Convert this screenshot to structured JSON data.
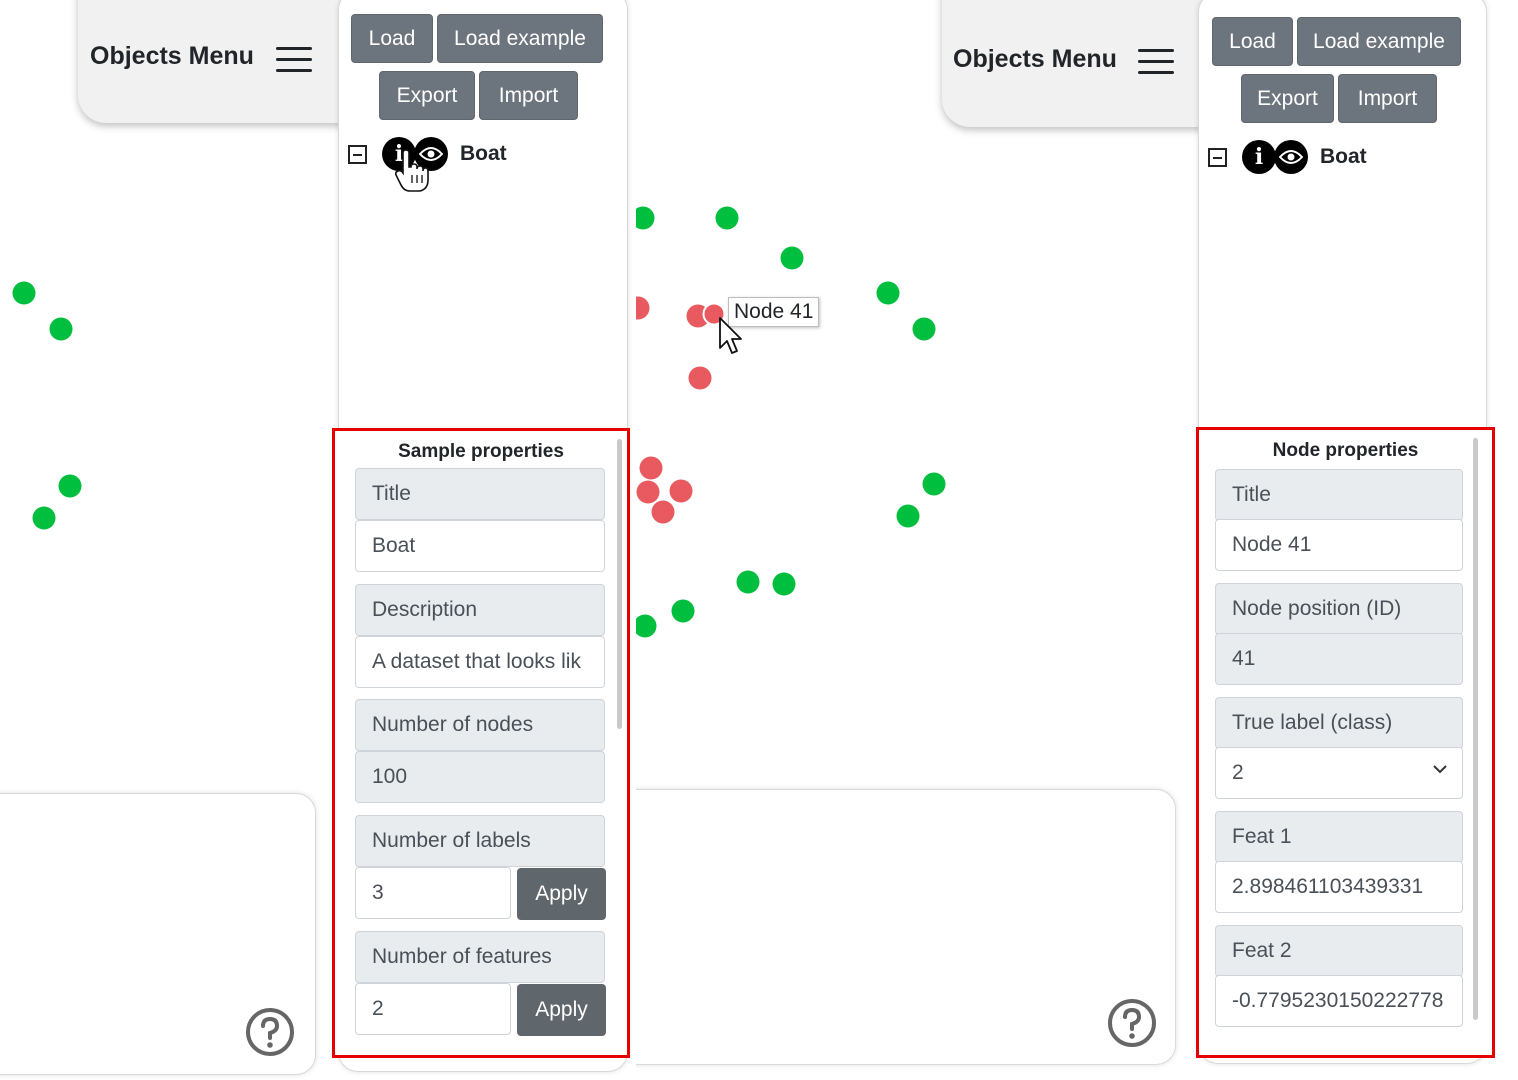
{
  "colors": {
    "class_green": "#00bf3f",
    "class_red": "#e85a5f",
    "highlight_border": "#e60000",
    "button_gray": "#6c757d"
  },
  "left": {
    "objects_menu": {
      "title": "Objects Menu",
      "icon": "hamburger-menu-icon"
    },
    "toolbar": {
      "load": "Load",
      "load_example": "Load example",
      "export": "Export",
      "import": "Import"
    },
    "tree": {
      "item_label": "Boat",
      "icons": [
        "collapse-icon",
        "info-icon",
        "eye-icon"
      ]
    },
    "properties": {
      "title": "Sample properties",
      "title_label": "Title",
      "title_value": "Boat",
      "description_label": "Description",
      "description_value": "A dataset that looks lik",
      "num_nodes_label": "Number of nodes",
      "num_nodes_value": "100",
      "num_labels_label": "Number of labels",
      "num_labels_value": "3",
      "num_features_label": "Number of features",
      "num_features_value": "2",
      "apply": "Apply"
    },
    "help_icon": "help-icon"
  },
  "right": {
    "objects_menu": {
      "title": "Objects Menu",
      "icon": "hamburger-menu-icon"
    },
    "toolbar": {
      "load": "Load",
      "load_example": "Load example",
      "export": "Export",
      "import": "Import"
    },
    "tree": {
      "item_label": "Boat",
      "icons": [
        "collapse-icon",
        "info-icon",
        "eye-icon"
      ]
    },
    "tooltip": "Node 41",
    "properties": {
      "title": "Node properties",
      "title_label": "Title",
      "title_value": "Node 41",
      "position_label": "Node position (ID)",
      "position_value": "41",
      "true_label_label": "True label (class)",
      "true_label_value": "2",
      "feat1_label": "Feat 1",
      "feat1_value": "2.898461103439331",
      "feat2_label": "Feat 2",
      "feat2_value": "-0.7795230150222778"
    },
    "help_icon": "help-icon"
  }
}
